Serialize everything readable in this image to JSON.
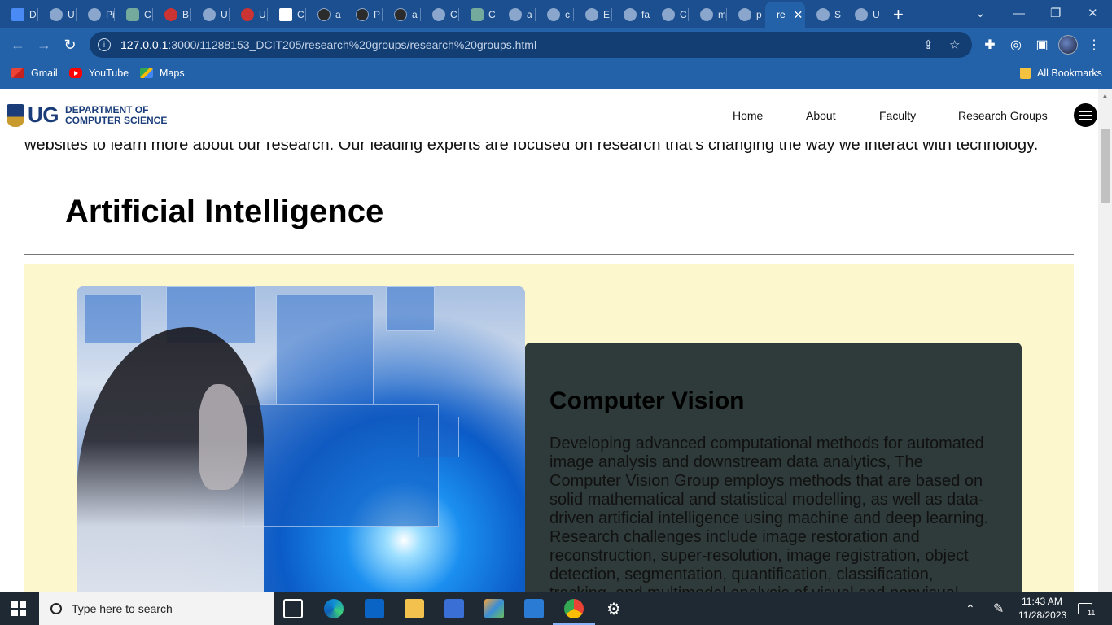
{
  "browser": {
    "tabs": [
      {
        "label": "D",
        "icon": "docs-icon"
      },
      {
        "label": "U",
        "icon": "loading-icon"
      },
      {
        "label": "Pi",
        "icon": "loading-icon"
      },
      {
        "label": "C",
        "icon": "chatgpt-icon"
      },
      {
        "label": "B",
        "icon": "globe-icon"
      },
      {
        "label": "U",
        "icon": "globe-icon"
      },
      {
        "label": "U",
        "icon": "globe-icon"
      },
      {
        "label": "C",
        "icon": "red-crest-icon"
      },
      {
        "label": "a",
        "icon": "github-icon"
      },
      {
        "label": "P",
        "icon": "github-icon"
      },
      {
        "label": "a",
        "icon": "github-icon"
      },
      {
        "label": "C",
        "icon": "gear-icon"
      },
      {
        "label": "C",
        "icon": "chatgpt-icon"
      },
      {
        "label": "a",
        "icon": "globe-icon"
      },
      {
        "label": "c",
        "icon": "globe-icon"
      },
      {
        "label": "E",
        "icon": "globe-icon"
      },
      {
        "label": "fa",
        "icon": "globe-icon"
      },
      {
        "label": "C",
        "icon": "globe-icon"
      },
      {
        "label": "m",
        "icon": "globe-icon"
      },
      {
        "label": "p",
        "icon": "globe-icon"
      },
      {
        "label": "re",
        "icon": "globe-icon",
        "active": true
      },
      {
        "label": "S",
        "icon": "globe-icon"
      },
      {
        "label": "U",
        "icon": "globe-icon"
      }
    ],
    "new_tab": "+",
    "close_tab": "✕",
    "address": {
      "host": "127.0.0.1",
      "path": ":3000/11288153_DCIT205/research%20groups/research%20groups.html"
    },
    "bookmarks": [
      {
        "label": "Gmail"
      },
      {
        "label": "YouTube"
      },
      {
        "label": "Maps"
      }
    ],
    "all_bookmarks": "All Bookmarks"
  },
  "site": {
    "logo_short": "UG",
    "logo_line1": "DEPARTMENT OF",
    "logo_line2": "COMPUTER SCIENCE",
    "nav": [
      "Home",
      "About",
      "Faculty",
      "Research Groups"
    ],
    "intro": "websites to learn more about our research. Our leading experts are focused on research that's changing the way we interact with technology.",
    "section_title": "Artificial Intelligence",
    "card": {
      "title": "Computer Vision",
      "body": "Developing advanced computational methods for automated image analysis and downstream data analytics, The Computer Vision Group employs methods that are based on solid mathematical and statistical modelling, as well as data-driven artificial intelligence using machine and deep learning. Research challenges include image restoration and reconstruction, super-resolution, image registration, object detection, segmentation, quantification, classification, tracking, and multimodal analysis of visual and nonvisual"
    }
  },
  "taskbar": {
    "search_placeholder": "Type here to search",
    "time": "11:43 AM",
    "date": "11/28/2023",
    "notifications": "11"
  },
  "colors": {
    "browser_chrome": "#2361a8",
    "tab_strip": "#1c4f8f",
    "panel_bg": "#fdf7cd",
    "card_bg": "#2f3b3a",
    "brand_blue": "#1a3d7a"
  }
}
